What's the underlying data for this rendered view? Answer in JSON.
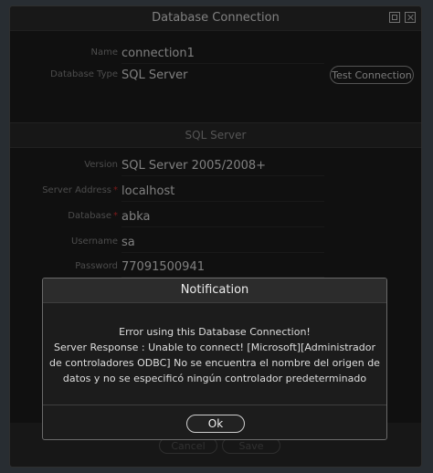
{
  "window": {
    "title": "Database Connection"
  },
  "connection": {
    "name_label": "Name",
    "name_value": "connection1",
    "type_label": "Database Type",
    "type_value": "SQL Server",
    "test_button": "Test Connection"
  },
  "section": {
    "title": "SQL Server"
  },
  "fields": {
    "version_label": "Version",
    "version_value": "SQL Server 2005/2008+",
    "server_label": "Server Address",
    "server_value": "localhost",
    "database_label": "Database",
    "database_value": "abka",
    "username_label": "Username",
    "username_value": "sa",
    "password_label": "Password",
    "password_value": "77091500941",
    "required_marker": "*"
  },
  "footer": {
    "cancel_label": "Cancel",
    "save_label": "Save"
  },
  "notification": {
    "title": "Notification",
    "line1": "Error using this Database Connection!",
    "line2": "Server Response : Unable to connect! [Microsoft][Administrador",
    "line3": "de controladores ODBC] No se encuentra el nombre del origen de",
    "line4": "datos y no se especificó ningún controlador predeterminado",
    "ok_label": "Ok"
  },
  "colors": {
    "required": "#e03030",
    "background": "#1e1e1e"
  },
  "icons": {
    "maximize": "maximize-icon",
    "close": "close-icon"
  }
}
